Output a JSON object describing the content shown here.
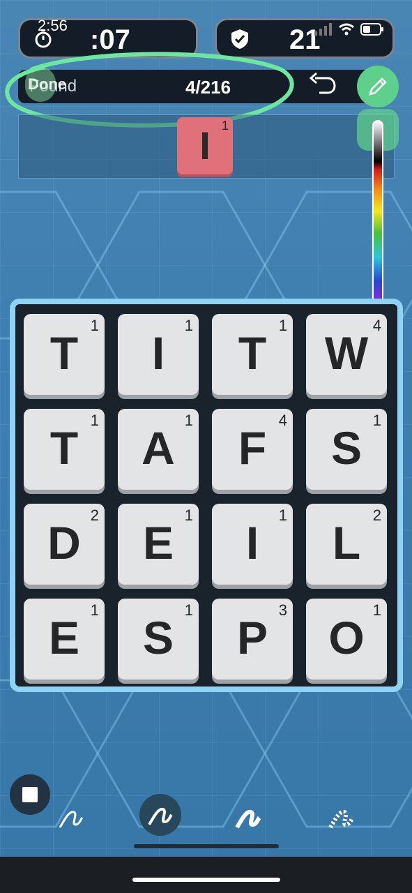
{
  "status_bar": {
    "time": "2:56"
  },
  "timer": {
    "value": ":07",
    "icon": "stopwatch-icon"
  },
  "score": {
    "value": "21",
    "icon": "shield-check-icon"
  },
  "found": {
    "label": "Found",
    "count": "4/216",
    "overlay_label": "Done"
  },
  "current_word": {
    "letter": "I",
    "points": "1"
  },
  "board": {
    "tiles": [
      {
        "letter": "T",
        "points": "1"
      },
      {
        "letter": "I",
        "points": "1"
      },
      {
        "letter": "T",
        "points": "1"
      },
      {
        "letter": "W",
        "points": "4"
      },
      {
        "letter": "T",
        "points": "1"
      },
      {
        "letter": "A",
        "points": "1"
      },
      {
        "letter": "F",
        "points": "4"
      },
      {
        "letter": "S",
        "points": "1"
      },
      {
        "letter": "D",
        "points": "2"
      },
      {
        "letter": "E",
        "points": "1"
      },
      {
        "letter": "I",
        "points": "1"
      },
      {
        "letter": "L",
        "points": "2"
      },
      {
        "letter": "E",
        "points": "1"
      },
      {
        "letter": "S",
        "points": "1"
      },
      {
        "letter": "P",
        "points": "3"
      },
      {
        "letter": "O",
        "points": "1"
      }
    ]
  },
  "markup_tools": [
    "pen-icon",
    "pencil-scribble-icon",
    "marker-icon",
    "highlighter-icon"
  ],
  "colors": {
    "accent_green": "#5fcf8c",
    "preview_tile": "#e0707a",
    "board_border": "#8fd2f3"
  }
}
